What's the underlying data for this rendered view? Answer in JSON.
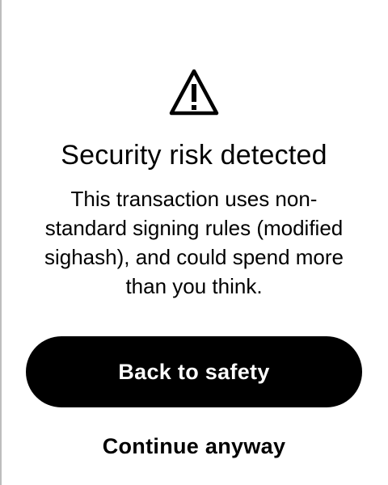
{
  "dialog": {
    "icon": "warning-triangle-icon",
    "title": "Security risk detected",
    "message": "This transaction uses non-standard signing rules (modified sighash), and could spend more than you think.",
    "primary_button_label": "Back to safety",
    "secondary_button_label": "Continue anyway"
  },
  "colors": {
    "background": "#ffffff",
    "text": "#000000",
    "primary_button_bg": "#000000",
    "primary_button_text": "#ffffff"
  }
}
